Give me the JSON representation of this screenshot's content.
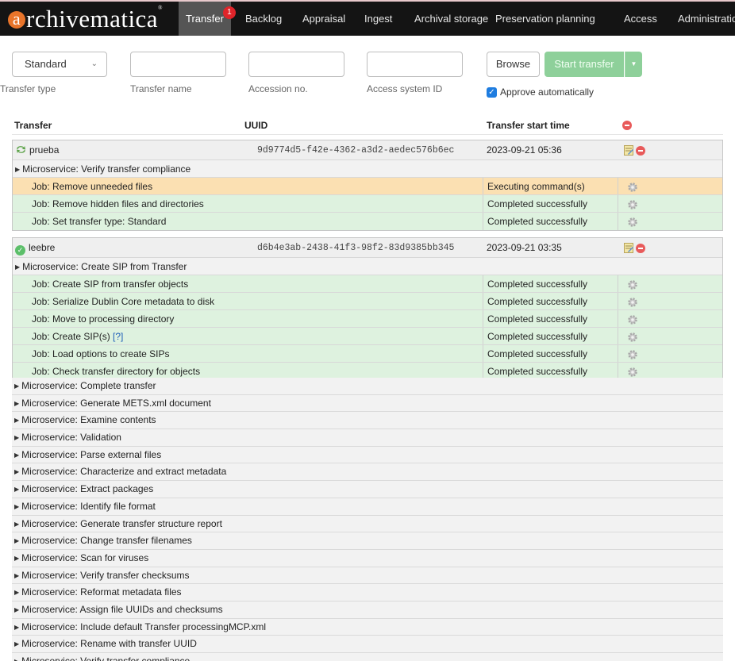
{
  "app": {
    "logo_text": "rchivematica",
    "logo_initial": "a",
    "logo_tm": "®",
    "accent_orange": "#e8742a"
  },
  "nav": {
    "items": [
      {
        "label": "Transfer",
        "active": true,
        "badge": "1"
      },
      {
        "label": "Backlog"
      },
      {
        "label": "Appraisal"
      },
      {
        "label": "Ingest"
      },
      {
        "label": "Archival storage"
      },
      {
        "label": "Preservation planning"
      },
      {
        "label": "Access"
      },
      {
        "label": "Administration"
      }
    ]
  },
  "form": {
    "transfer_type_value": "Standard",
    "transfer_type_label": "Transfer type",
    "transfer_name_label": "Transfer name",
    "transfer_name_value": "",
    "accession_label": "Accession no.",
    "accession_value": "",
    "access_system_label": "Access system ID",
    "access_system_value": "",
    "browse_label": "Browse",
    "start_label": "Start transfer",
    "approve_label": "Approve automatically",
    "approve_checked": true
  },
  "table": {
    "headers": {
      "transfer": "Transfer",
      "uuid": "UUID",
      "start_time": "Transfer start time"
    },
    "transfers": [
      {
        "name": "prueba",
        "status_icon": "sync-icon",
        "uuid": "9d9774d5-f42e-4362-a3d2-aedec576b6ec",
        "start_time": "2023-09-21 05:36",
        "microservice": "Microservice: Verify transfer compliance",
        "jobs": [
          {
            "name": "Job: Remove unneeded files",
            "status": "Executing command(s)",
            "state": "exec"
          },
          {
            "name": "Job: Remove hidden files and directories",
            "status": "Completed successfully",
            "state": "ok"
          },
          {
            "name": "Job: Set transfer type: Standard",
            "status": "Completed successfully",
            "state": "ok"
          }
        ]
      },
      {
        "name": "leebre",
        "status_icon": "completed-icon",
        "uuid": "d6b4e3ab-2438-41f3-98f2-83d9385bb345",
        "start_time": "2023-09-21 03:35",
        "microservice": "Microservice: Create SIP from Transfer",
        "jobs": [
          {
            "name": "Job: Create SIP from transfer objects",
            "status": "Completed successfully",
            "state": "ok"
          },
          {
            "name": "Job: Serialize Dublin Core metadata to disk",
            "status": "Completed successfully",
            "state": "ok"
          },
          {
            "name": "Job: Move to processing directory",
            "status": "Completed successfully",
            "state": "ok"
          },
          {
            "name": "Job: Create SIP(s)",
            "help": "[?]",
            "status": "Completed successfully",
            "state": "ok"
          },
          {
            "name": "Job: Load options to create SIPs",
            "status": "Completed successfully",
            "state": "ok"
          },
          {
            "name": "Job: Check transfer directory for objects",
            "status": "Completed successfully",
            "state": "ok"
          }
        ]
      }
    ],
    "more_microservices": [
      "Microservice: Complete transfer",
      "Microservice: Generate METS.xml document",
      "Microservice: Examine contents",
      "Microservice: Validation",
      "Microservice: Parse external files",
      "Microservice: Characterize and extract metadata",
      "Microservice: Extract packages",
      "Microservice: Identify file format",
      "Microservice: Generate transfer structure report",
      "Microservice: Change transfer filenames",
      "Microservice: Scan for viruses",
      "Microservice: Verify transfer checksums",
      "Microservice: Reformat metadata files",
      "Microservice: Assign file UUIDs and checksums",
      "Microservice: Include default Transfer processingMCP.xml",
      "Microservice: Rename with transfer UUID",
      "Microservice: Verify transfer compliance"
    ]
  },
  "colors": {
    "job_ok": "#def2df",
    "job_exec": "#fbe0b2",
    "start_button": "#8ed09a",
    "delete": "#e85a5a"
  }
}
